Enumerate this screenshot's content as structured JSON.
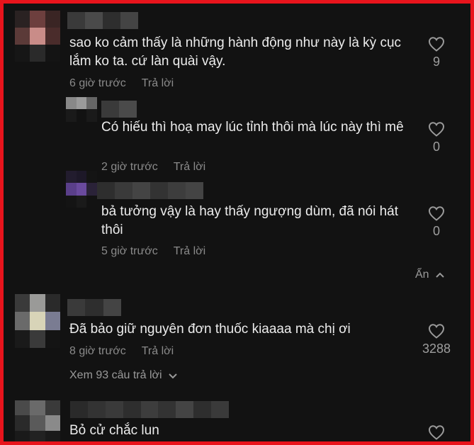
{
  "comments": [
    {
      "text": "sao ko cảm thấy là những hành động như này là kỳ cục lắm ko ta. cứ làn quài vậy.",
      "time": "6 giờ trước",
      "reply": "Trả lời",
      "likes": "9"
    },
    {
      "text": "Có hiếu thì hoạ may lúc tỉnh thôi mà lúc này thì mê",
      "time": "2 giờ trước",
      "reply": "Trả lời",
      "likes": "0"
    },
    {
      "text": "bả tưởng vậy là hay thấy ngượng dùm, đã nói hát thôi",
      "time": "5 giờ trước",
      "reply": "Trả lời",
      "likes": "0"
    },
    {
      "text": "Đã bảo giữ nguyên đơn thuốc kiaaaa mà chị ơi",
      "time": "8 giờ trước",
      "reply": "Trả lời",
      "likes": "3288"
    },
    {
      "text": "Bỏ cử chắc lun",
      "likes": ""
    }
  ],
  "hide_label": "Ẩn",
  "view_replies_label": "Xem 93 câu trả lời",
  "icons": {
    "like": "heart-outline-icon",
    "hide": "chevron-up-icon",
    "more": "chevron-down-icon"
  },
  "colors": {
    "background": "#121212",
    "border": "#e8141c",
    "muted": "#8a8a8a"
  }
}
